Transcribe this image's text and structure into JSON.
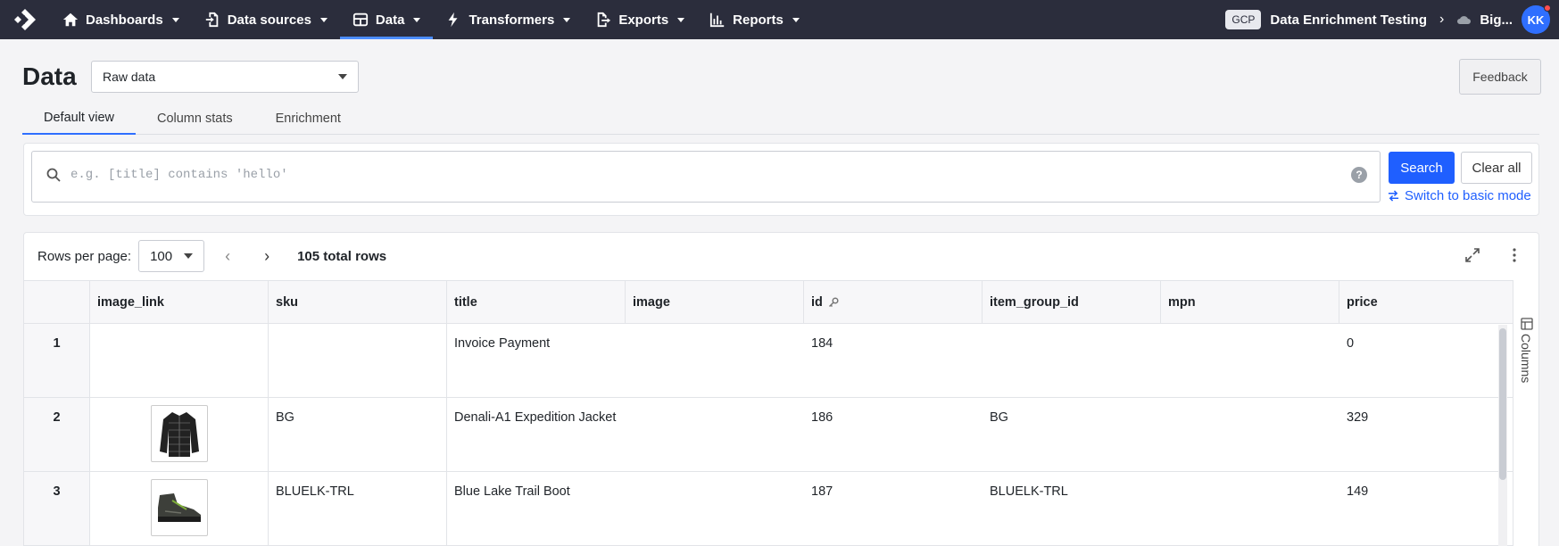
{
  "nav": {
    "items": [
      {
        "label": "Dashboards",
        "icon": "home-icon"
      },
      {
        "label": "Data sources",
        "icon": "file-import-icon"
      },
      {
        "label": "Data",
        "icon": "table-icon",
        "active": true
      },
      {
        "label": "Transformers",
        "icon": "bolt-icon"
      },
      {
        "label": "Exports",
        "icon": "file-export-icon"
      },
      {
        "label": "Reports",
        "icon": "bar-chart-icon"
      }
    ],
    "gcp_badge": "GCP",
    "project": "Data Enrichment Testing",
    "dataset": "Big...",
    "avatar_initials": "KK"
  },
  "header": {
    "title": "Data",
    "view_select": "Raw data",
    "feedback_label": "Feedback"
  },
  "tabs": [
    "Default view",
    "Column stats",
    "Enrichment"
  ],
  "search": {
    "placeholder": "e.g. [title] contains 'hello'",
    "help": "?",
    "search_label": "Search",
    "clear_label": "Clear all",
    "switch_label": "Switch to basic mode"
  },
  "pager": {
    "rows_per_page_label": "Rows per page:",
    "rows_per_page": "100",
    "total": "105 total rows"
  },
  "table": {
    "columns": [
      "image_link",
      "sku",
      "title",
      "image",
      "id",
      "item_group_id",
      "mpn",
      "price"
    ],
    "rows": [
      {
        "num": "1",
        "sku": "",
        "title": "Invoice Payment",
        "image": "",
        "id": "184",
        "item_group_id": "",
        "mpn": "",
        "price": "0",
        "thumb": ""
      },
      {
        "num": "2",
        "sku": "BG",
        "title": "Denali-A1 Expedition Jacket",
        "image": "",
        "id": "186",
        "item_group_id": "BG",
        "mpn": "",
        "price": "329",
        "thumb": "jacket"
      },
      {
        "num": "3",
        "sku": "BLUELK-TRL",
        "title": "Blue Lake Trail Boot",
        "image": "",
        "id": "187",
        "item_group_id": "BLUELK-TRL",
        "mpn": "",
        "price": "149",
        "thumb": "boot"
      }
    ]
  },
  "columns_panel_label": "Columns"
}
